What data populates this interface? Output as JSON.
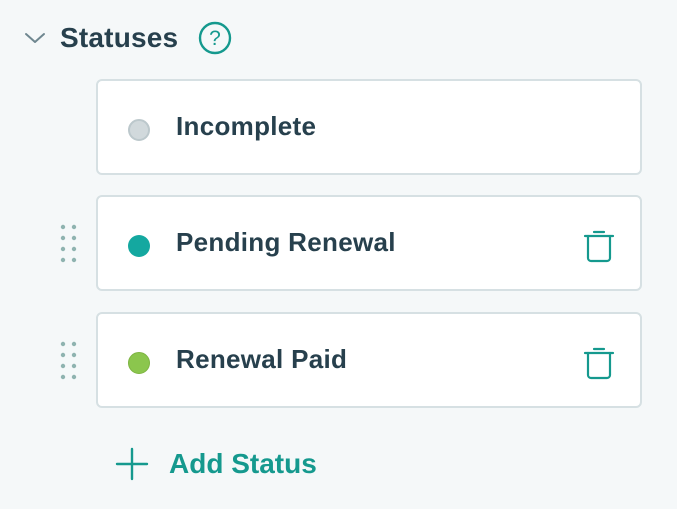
{
  "section": {
    "title": "Statuses",
    "collapse_icon": "chevron-down-icon",
    "help_icon": "question-circle-icon",
    "help_glyph": "?"
  },
  "statuses": [
    {
      "label": "Incomplete",
      "color": "#d1d9dc",
      "deletable": false,
      "draggable": false
    },
    {
      "label": "Pending Renewal",
      "color": "#14a8a0",
      "deletable": true,
      "draggable": true
    },
    {
      "label": "Renewal Paid",
      "color": "#8bc64d",
      "deletable": true,
      "draggable": true
    }
  ],
  "add_status": {
    "label": "Add Status",
    "icon": "plus-icon"
  },
  "colors": {
    "accent": "#15998e",
    "text": "#27404d",
    "border": "#d6e0e3",
    "handle": "#8fb3b0"
  }
}
